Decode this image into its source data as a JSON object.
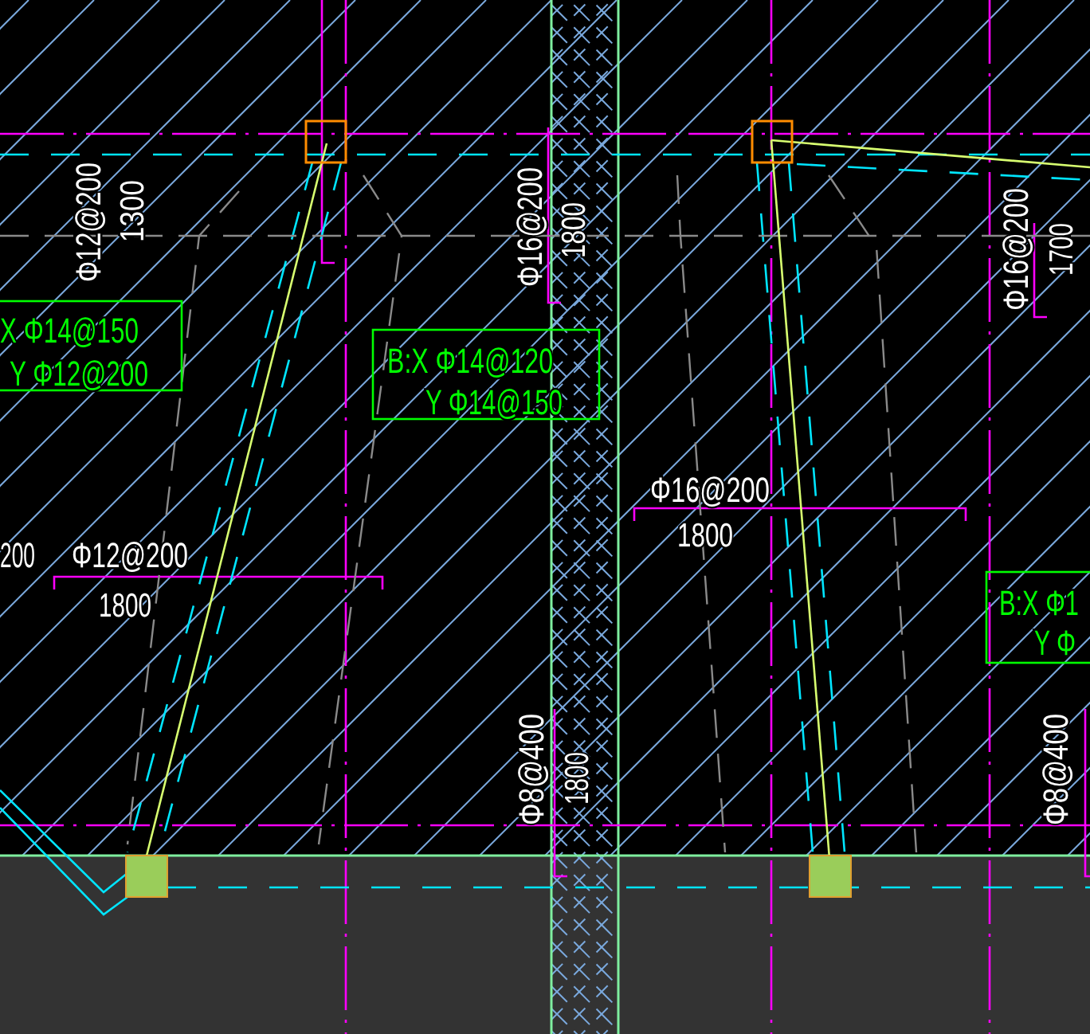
{
  "annotations": [
    {
      "kind": "rebar",
      "text": "Φ12@200"
    },
    {
      "kind": "dimension",
      "text": "1300"
    },
    {
      "kind": "rebar",
      "text": "Φ16@200"
    },
    {
      "kind": "dimension",
      "text": "1800"
    },
    {
      "kind": "rebar",
      "text": "Φ16@200"
    },
    {
      "kind": "dimension",
      "text": "1700"
    },
    {
      "kind": "rebar",
      "text": "200"
    },
    {
      "kind": "rebar",
      "text": "Φ12@200"
    },
    {
      "kind": "dimension",
      "text": "1800"
    },
    {
      "kind": "rebar",
      "text": "Φ16@200"
    },
    {
      "kind": "dimension",
      "text": "1800"
    },
    {
      "kind": "rebar",
      "text": "Φ8@400"
    },
    {
      "kind": "dimension",
      "text": "1800"
    },
    {
      "kind": "rebar",
      "text": "Φ8@400"
    }
  ],
  "slab_notes": [
    {
      "lines": [
        "X Φ14@150",
        "Y Φ12@200"
      ]
    },
    {
      "lines": [
        "B:X Φ14@120",
        "Y Φ14@150"
      ]
    },
    {
      "lines": [
        "B:X Φ1",
        "Y Φ"
      ]
    }
  ]
}
